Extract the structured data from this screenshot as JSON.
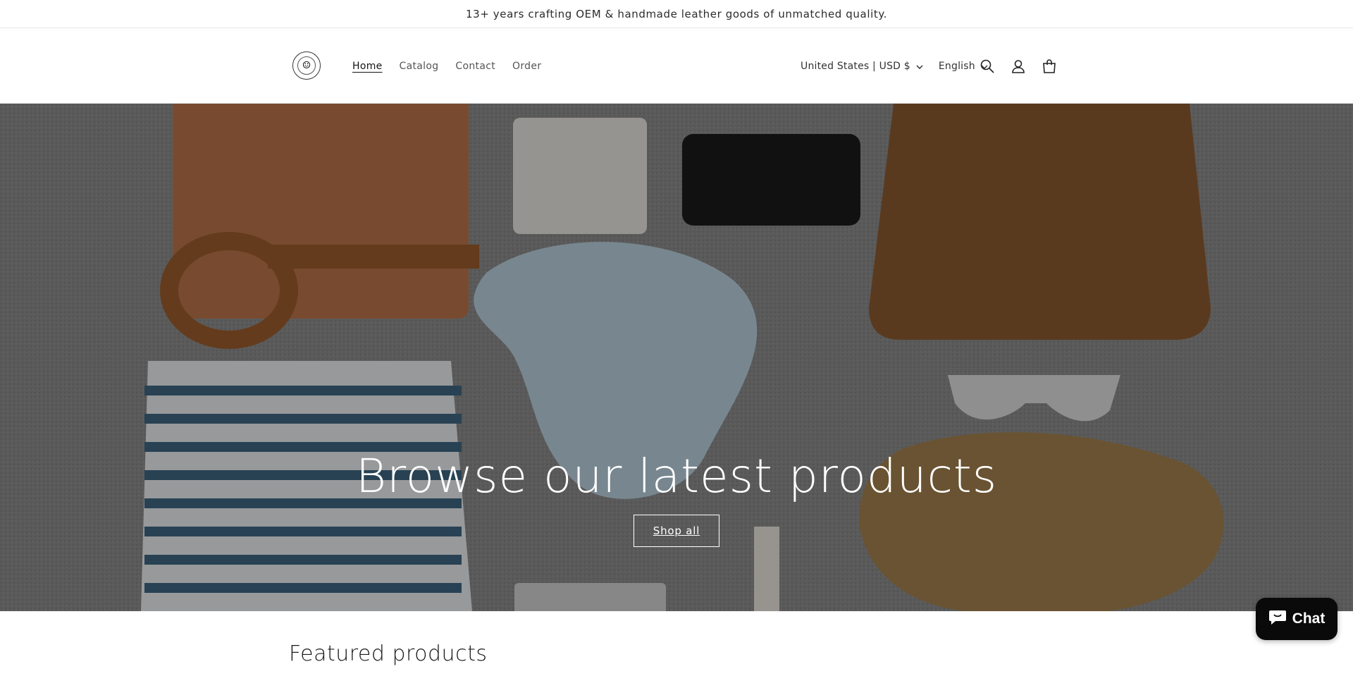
{
  "announcement": {
    "text": "13+ years crafting OEM & handmade leather goods of unmatched quality."
  },
  "header": {
    "logo_icon": "seal-logo",
    "nav": [
      {
        "label": "Home",
        "active": true
      },
      {
        "label": "Catalog",
        "active": false
      },
      {
        "label": "Contact",
        "active": false
      },
      {
        "label": "Order",
        "active": false
      }
    ],
    "country_selector": "United States | USD $",
    "language_selector": "English",
    "icons": [
      "search-icon",
      "account-icon",
      "cart-icon"
    ]
  },
  "hero": {
    "title": "Browse our latest products",
    "button_label": "Shop all"
  },
  "featured": {
    "title": "Featured products"
  },
  "chat": {
    "label": "Chat"
  }
}
